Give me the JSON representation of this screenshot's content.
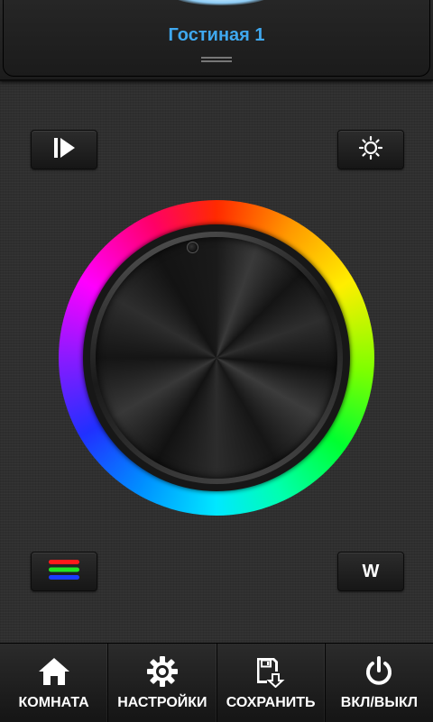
{
  "header": {
    "room_title": "Гостиная 1"
  },
  "controls": {
    "play_icon": "play-step-icon",
    "brightness_icon": "sun-icon",
    "rgb_icon": "rgb-lines-icon",
    "white_label": "W"
  },
  "wheel": {
    "colors": [
      "#ff2a00",
      "#ff9900",
      "#ffee00",
      "#7dff00",
      "#00ff30",
      "#00ffb0",
      "#00e8ff",
      "#0090ff",
      "#2030ff",
      "#8a1aff",
      "#ff00ff",
      "#ff0066"
    ]
  },
  "toolbar": {
    "items": [
      {
        "label": "КОМНАТА",
        "icon": "home-icon"
      },
      {
        "label": "НАСТРОЙКИ",
        "icon": "gear-icon"
      },
      {
        "label": "СОХРАНИТЬ",
        "icon": "save-icon"
      },
      {
        "label": "ВКЛ/ВЫКЛ",
        "icon": "power-icon"
      }
    ]
  },
  "colors": {
    "accent": "#3fa8ef",
    "background": "#2f2f2f"
  }
}
